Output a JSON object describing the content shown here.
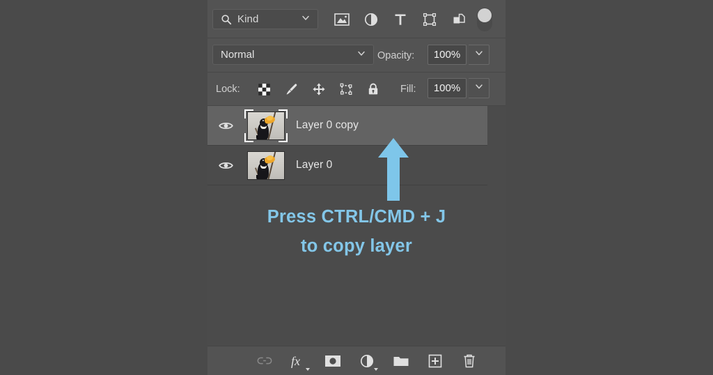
{
  "panel": {
    "name": "Layers"
  },
  "filter_bar": {
    "kind_label": "Kind",
    "search_icon": "search-icon",
    "caret_icon": "chevron-down-icon",
    "filter_icons": [
      {
        "name": "filter-pixel-layers-icon",
        "title": "Pixel layers"
      },
      {
        "name": "filter-adjustment-layers-icon",
        "title": "Adjustment layers"
      },
      {
        "name": "filter-type-layers-icon",
        "title": "Type layers"
      },
      {
        "name": "filter-shape-layers-icon",
        "title": "Shape layers"
      },
      {
        "name": "filter-smart-object-layers-icon",
        "title": "Smart objects"
      }
    ],
    "toggle": {
      "name": "filter-enable-toggle",
      "state": "on"
    }
  },
  "blend_row": {
    "blend_mode": "Normal",
    "blend_caret": "chevron-down-icon",
    "opacity_label": "Opacity:",
    "opacity_value": "100%",
    "opacity_caret": "chevron-down-icon"
  },
  "lock_row": {
    "lock_label": "Lock:",
    "lock_icons": [
      {
        "name": "lock-transparent-pixels-icon",
        "title": "Lock transparent pixels"
      },
      {
        "name": "lock-image-pixels-icon",
        "title": "Lock image pixels"
      },
      {
        "name": "lock-position-icon",
        "title": "Lock position"
      },
      {
        "name": "lock-artboard-nesting-icon",
        "title": "Prevent auto-nesting"
      },
      {
        "name": "lock-all-icon",
        "title": "Lock all"
      }
    ],
    "fill_label": "Fill:",
    "fill_value": "100%",
    "fill_caret": "chevron-down-icon"
  },
  "layers": [
    {
      "name": "Layer 0 copy",
      "selected": true,
      "visible": true,
      "thumbnail": "toucan-photo-thumbnail",
      "eye_icon": "eye-icon"
    },
    {
      "name": "Layer 0",
      "selected": false,
      "visible": true,
      "thumbnail": "toucan-photo-thumbnail",
      "eye_icon": "eye-icon"
    }
  ],
  "callout": {
    "line1": "Press CTRL/CMD + J",
    "line2": "to copy layer",
    "color": "#83c6e8",
    "arrow": "up-arrow"
  },
  "bottom_bar": {
    "buttons": [
      {
        "name": "link-layers-button",
        "icon": "link-icon",
        "label": "Link layers",
        "disabled": true
      },
      {
        "name": "layer-style-button",
        "icon": "fx-icon",
        "label": "Add a layer style",
        "disabled": false
      },
      {
        "name": "layer-mask-button",
        "icon": "mask-icon",
        "label": "Add layer mask",
        "disabled": false
      },
      {
        "name": "adjustment-layer-button",
        "icon": "half-circle-icon",
        "label": "Create new fill or adjustment layer",
        "disabled": false
      },
      {
        "name": "new-group-button",
        "icon": "folder-icon",
        "label": "Create a new group",
        "disabled": false
      },
      {
        "name": "new-layer-button",
        "icon": "plus-square-icon",
        "label": "Create a new layer",
        "disabled": false
      },
      {
        "name": "delete-layer-button",
        "icon": "trash-icon",
        "label": "Delete layer",
        "disabled": false
      }
    ]
  },
  "colors": {
    "background": "#4a4a4a",
    "panel": "#535353",
    "list": "#4b4b4b",
    "selected_row": "#636363",
    "accent": "#83c6e8"
  }
}
